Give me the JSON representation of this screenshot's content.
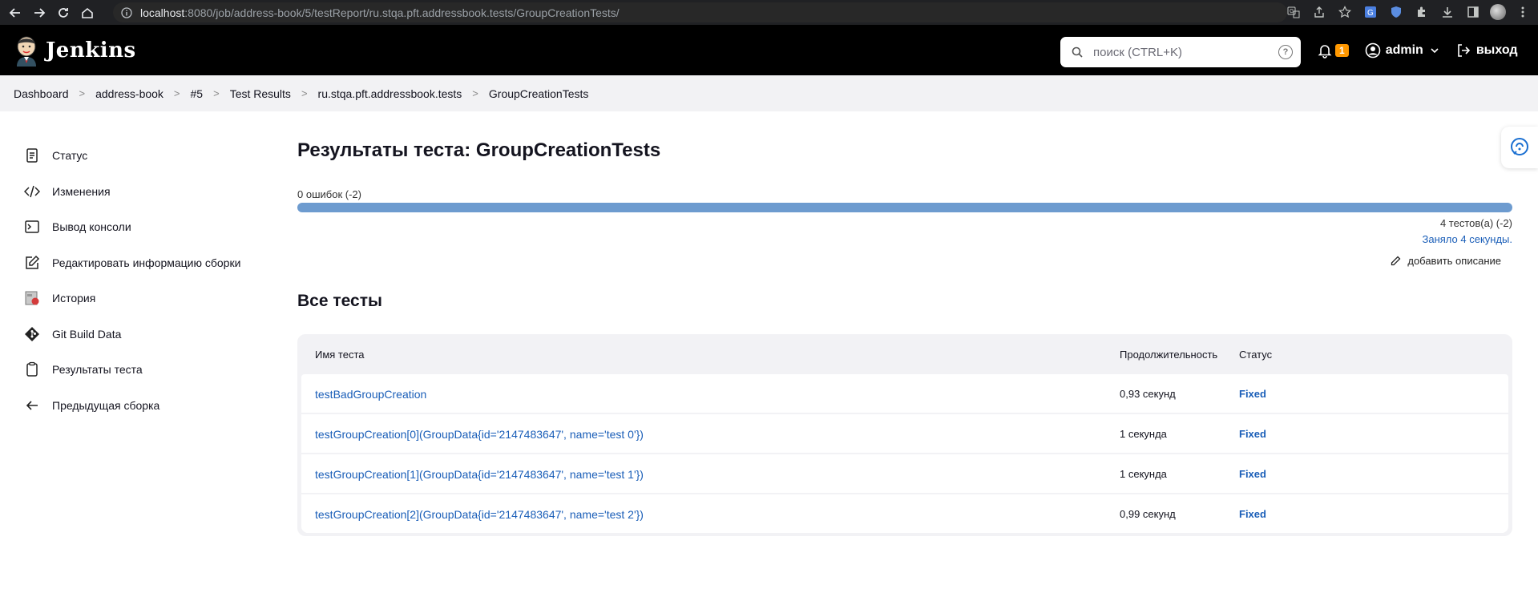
{
  "browser": {
    "url_host": "localhost",
    "url_rest": ":8080/job/address-book/5/testReport/ru.stqa.pft.addressbook.tests/GroupCreationTests/"
  },
  "header": {
    "brand": "Jenkins",
    "search_placeholder": "поиск (CTRL+K)",
    "search_help": "?",
    "notifications_count": "1",
    "user": "admin",
    "logout": "выход"
  },
  "breadcrumb": [
    "Dashboard",
    "address-book",
    "#5",
    "Test Results",
    "ru.stqa.pft.addressbook.tests",
    "GroupCreationTests"
  ],
  "sidebar": {
    "items": [
      {
        "label": "Статус",
        "icon": "status-icon"
      },
      {
        "label": "Изменения",
        "icon": "code-icon"
      },
      {
        "label": "Вывод консоли",
        "icon": "terminal-icon"
      },
      {
        "label": "Редактировать информацию сборки",
        "icon": "edit-icon"
      },
      {
        "label": "История",
        "icon": "history-icon"
      },
      {
        "label": "Git Build Data",
        "icon": "git-icon"
      },
      {
        "label": "Результаты теста",
        "icon": "clipboard-icon"
      },
      {
        "label": "Предыдущая сборка",
        "icon": "arrow-left-icon"
      }
    ]
  },
  "main": {
    "title": "Результаты теста: GroupCreationTests",
    "failures": "0 ошибок (-2)",
    "progress_pass_fraction": 1.0,
    "tests_count": "4 тестов(а) (-2)",
    "took": "Заняло 4 секунды.",
    "add_description": "добавить описание",
    "section_title": "Все тесты",
    "table": {
      "headers": {
        "name": "Имя теста",
        "duration": "Продолжительность",
        "status": "Статус"
      },
      "rows": [
        {
          "name": "testBadGroupCreation",
          "duration": "0,93 секунд",
          "status": "Fixed"
        },
        {
          "name": "testGroupCreation[0](GroupData{id='2147483647', name='test 0'})",
          "duration": "1 секунда",
          "status": "Fixed"
        },
        {
          "name": "testGroupCreation[1](GroupData{id='2147483647', name='test 1'})",
          "duration": "1 секунда",
          "status": "Fixed"
        },
        {
          "name": "testGroupCreation[2](GroupData{id='2147483647', name='test 2'})",
          "duration": "0,99 секунд",
          "status": "Fixed"
        }
      ]
    }
  },
  "colors": {
    "link": "#1a5eb8",
    "progress_pass": "#6d9bcf",
    "header_bg": "#000000",
    "badge": "#ff9800"
  }
}
